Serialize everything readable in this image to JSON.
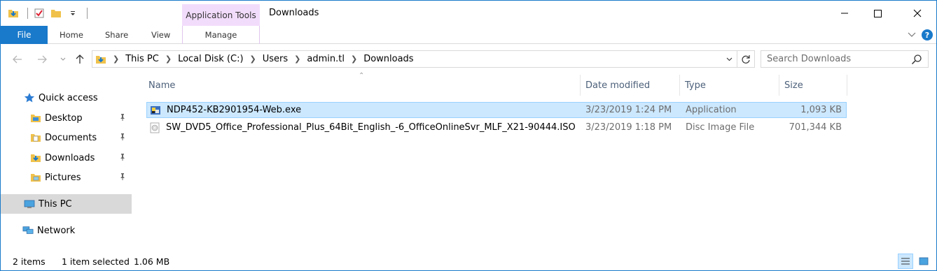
{
  "window": {
    "title": "Downloads",
    "context_tab_group": "Application Tools",
    "accent": "#1979ca",
    "context_color": "#f2dcfb"
  },
  "ribbon": {
    "tabs": [
      "File",
      "Home",
      "Share",
      "View"
    ],
    "context_tab": "Manage"
  },
  "address": {
    "breadcrumbs": [
      "This PC",
      "Local Disk (C:)",
      "Users",
      "admin.tl",
      "Downloads"
    ],
    "search_placeholder": "Search Downloads"
  },
  "nav": {
    "quick_access": "Quick access",
    "pinned": [
      {
        "label": "Desktop",
        "icon": "desktop-folder-icon"
      },
      {
        "label": "Documents",
        "icon": "documents-folder-icon"
      },
      {
        "label": "Downloads",
        "icon": "downloads-folder-icon"
      },
      {
        "label": "Pictures",
        "icon": "pictures-folder-icon"
      }
    ],
    "this_pc": "This PC",
    "network": "Network"
  },
  "columns": [
    "Name",
    "Date modified",
    "Type",
    "Size"
  ],
  "files": [
    {
      "name": "NDP452-KB2901954-Web.exe",
      "date": "3/23/2019 1:24 PM",
      "type": "Application",
      "size": "1,093 KB",
      "selected": true,
      "icon": "installer-exe-icon"
    },
    {
      "name": "SW_DVD5_Office_Professional_Plus_64Bit_English_-6_OfficeOnlineSvr_MLF_X21-90444.ISO",
      "date": "3/23/2019 1:18 PM",
      "type": "Disc Image File",
      "size": "701,344 KB",
      "selected": false,
      "icon": "disc-image-icon"
    }
  ],
  "status": {
    "item_count": "2 items",
    "selection": "1 item selected",
    "selection_size": "1.06 MB"
  }
}
